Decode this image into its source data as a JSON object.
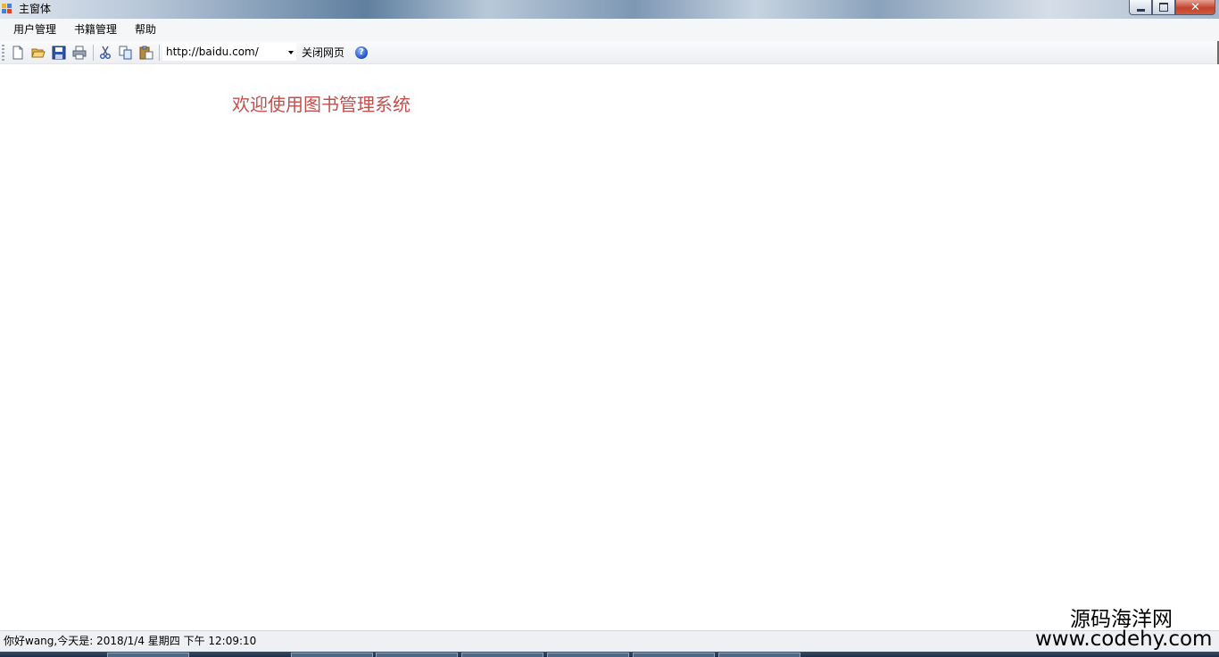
{
  "window": {
    "title": "主窗体",
    "icon": "app-window-icon",
    "controls": {
      "minimize": "minimize-icon",
      "maximize": "restore-icon",
      "close": "✕"
    }
  },
  "menubar": {
    "items": [
      {
        "label": "用户管理"
      },
      {
        "label": "书籍管理"
      },
      {
        "label": "帮助"
      }
    ]
  },
  "toolbar": {
    "icons": [
      "new-file-icon",
      "open-folder-icon",
      "save-icon",
      "print-icon",
      "cut-icon",
      "copy-icon",
      "paste-icon"
    ],
    "url_value": "http://baidu.com/",
    "close_page_label": "关闭网页",
    "help_glyph": "?"
  },
  "content": {
    "welcome_text": "欢迎使用图书管理系统",
    "welcome_color": "#c0504d"
  },
  "statusbar": {
    "text": "你好wang,今天是:  2018/1/4 星期四 下午 12:09:10"
  },
  "watermark": {
    "name": "源码海洋网",
    "url": "www.codehy.com"
  }
}
